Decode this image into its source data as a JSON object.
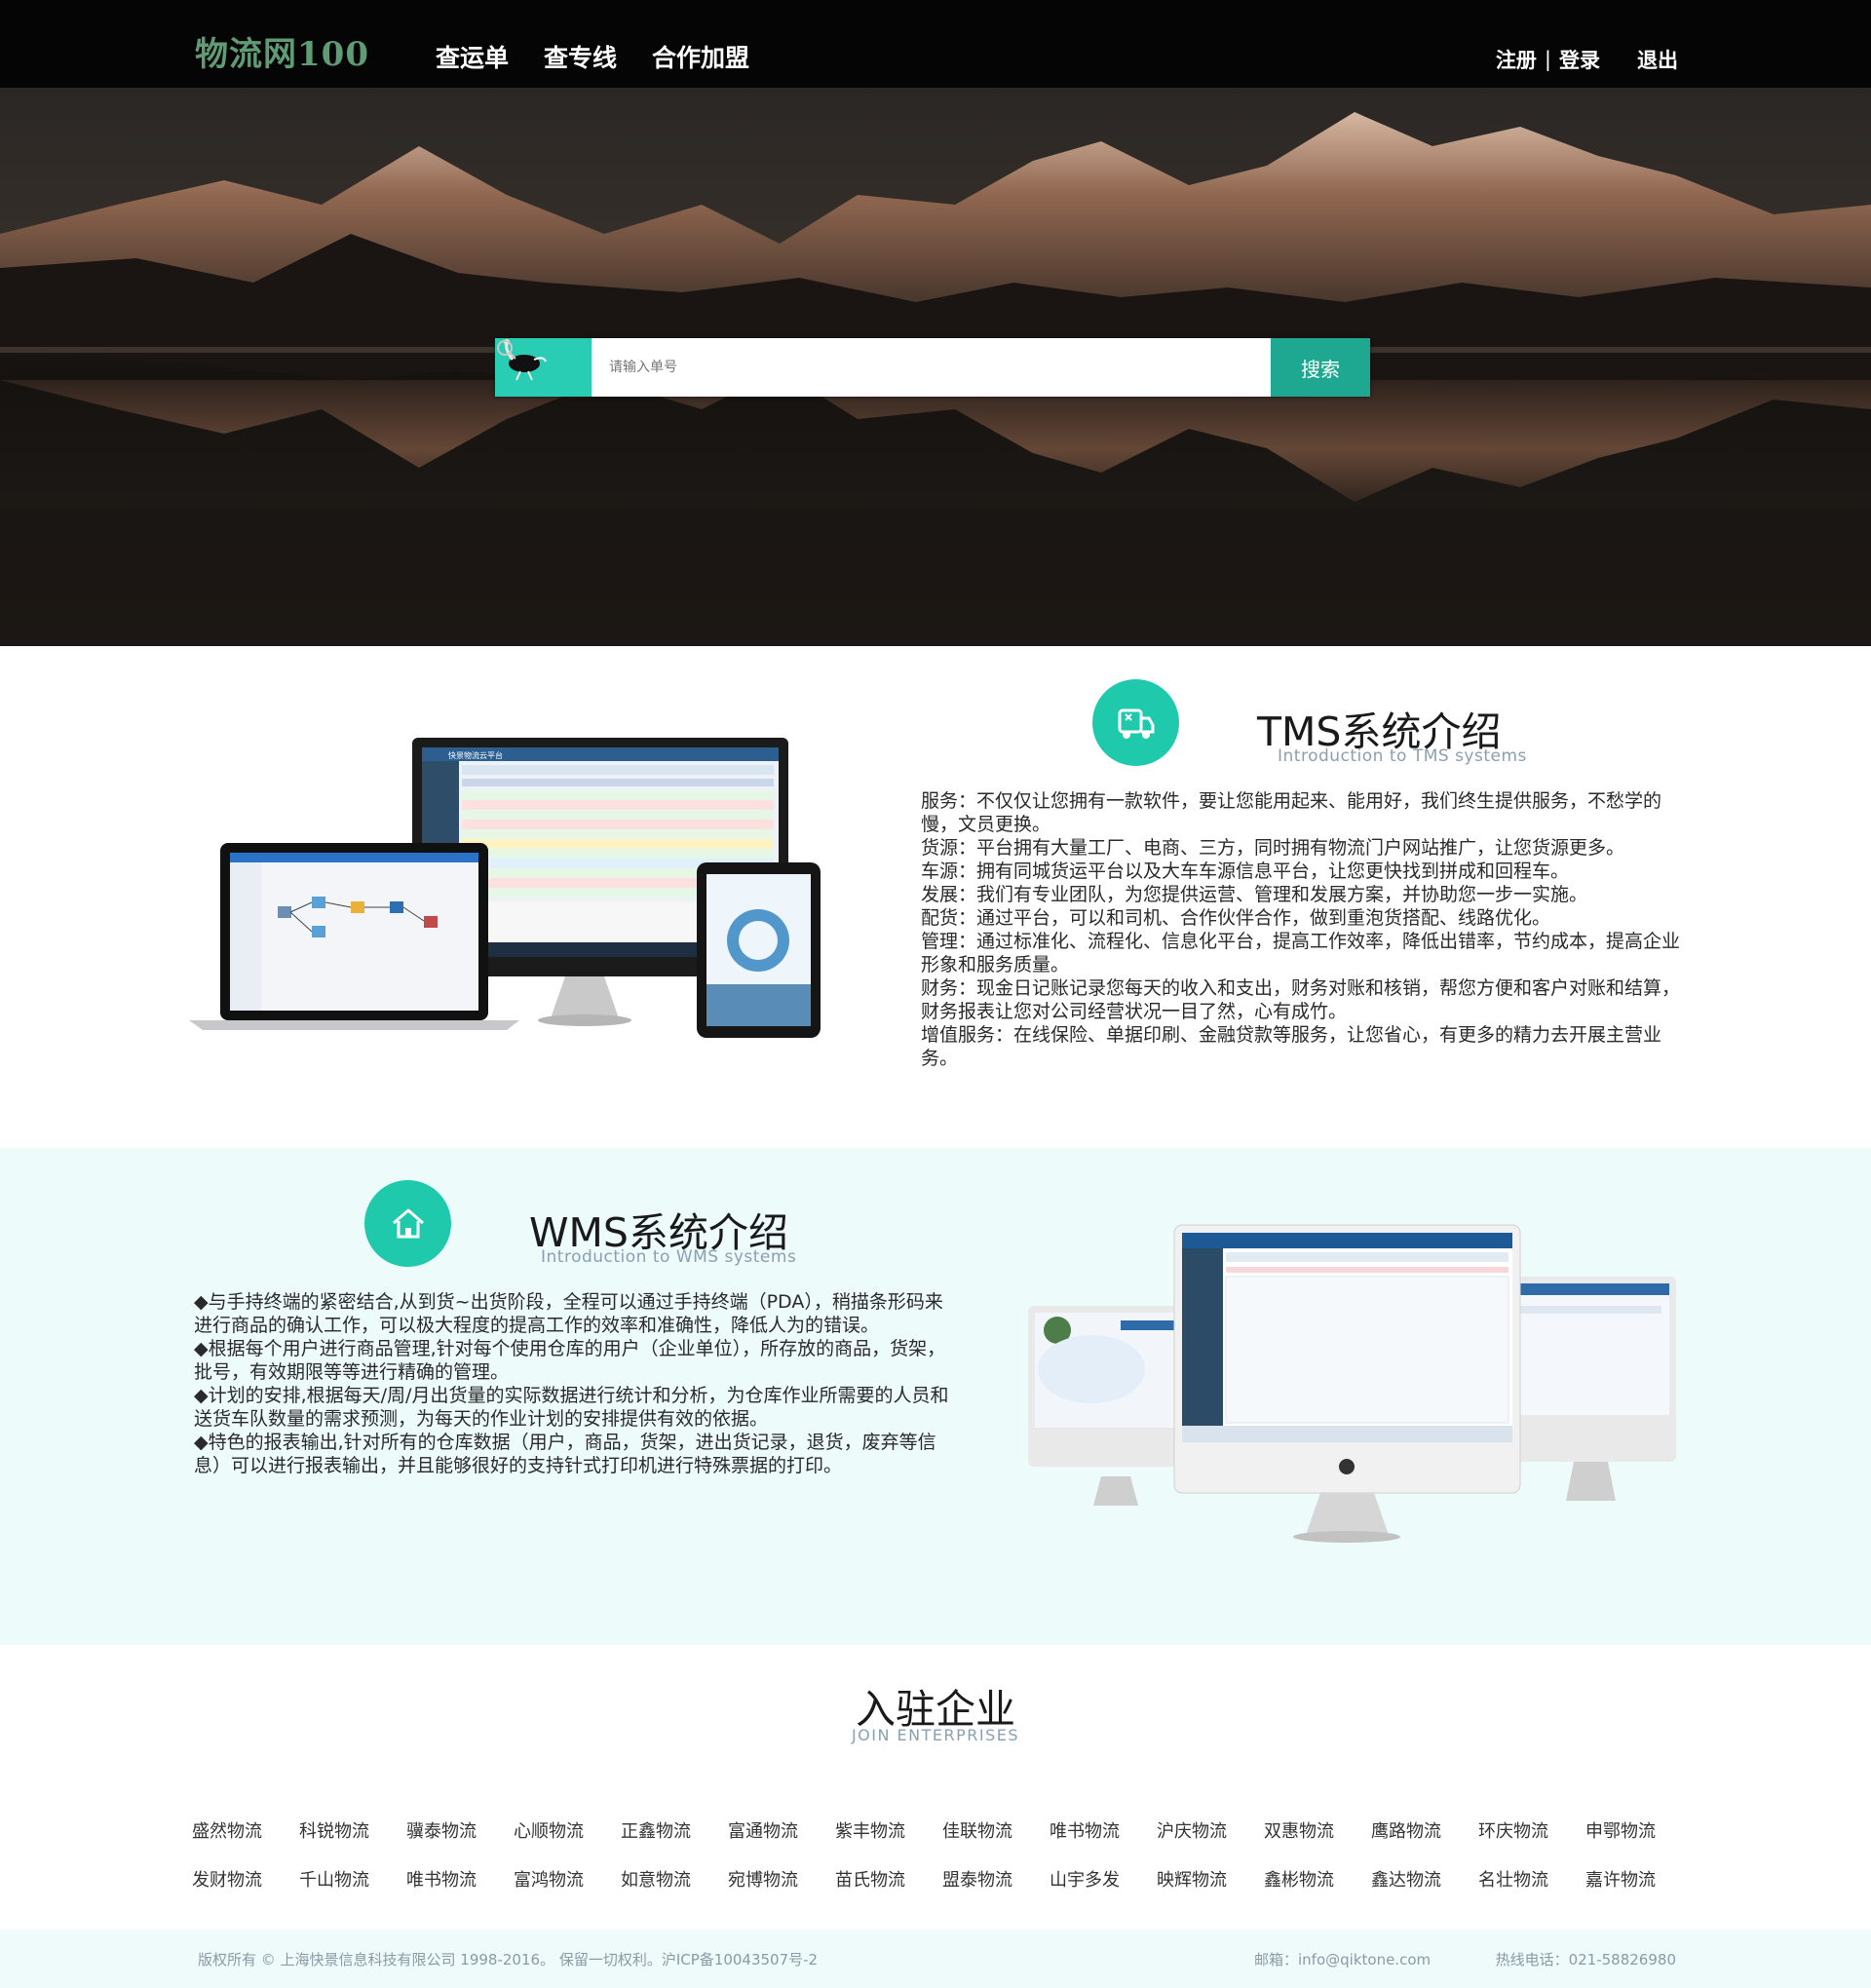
{
  "header": {
    "logo": "物流网100",
    "nav": [
      "查运单",
      "查专线",
      "合作加盟"
    ],
    "register": "注册",
    "separator": "|",
    "login": "登录",
    "logout": "退出"
  },
  "search": {
    "badge_icon": "ostrich-icon",
    "placeholder": "请输入单号",
    "button": "搜索"
  },
  "tms": {
    "icon": "delivery-truck-icon",
    "title": "TMS系统介绍",
    "subtitle": "Introduction to TMS systems",
    "screen_header": "快景物流云平台",
    "paragraphs": [
      "服务：不仅仅让您拥有一款软件，要让您能用起来、能用好，我们终生提供服务，不愁学的慢，文员更换。",
      "货源：平台拥有大量工厂、电商、三方，同时拥有物流门户网站推广，让您货源更多。",
      "车源：拥有同城货运平台以及大车车源信息平台，让您更快找到拼成和回程车。",
      "发展：我们有专业团队，为您提供运营、管理和发展方案，并协助您一步一实施。",
      "配货：通过平台，可以和司机、合作伙伴合作，做到重泡货搭配、线路优化。",
      "管理：通过标准化、流程化、信息化平台，提高工作效率，降低出错率，节约成本，提高企业形象和服务质量。",
      "财务：现金日记账记录您每天的收入和支出，财务对账和核销，帮您方便和客户对账和结算，财务报表让您对公司经营状况一目了然，心有成竹。",
      "增值服务：在线保险、单据印刷、金融贷款等服务，让您省心，有更多的精力去开展主营业务。"
    ]
  },
  "wms": {
    "icon": "home-icon",
    "title": "WMS系统介绍",
    "subtitle": "Introduction to WMS systems",
    "paragraphs": [
      "◆与手持终端的紧密结合,从到货~出货阶段，全程可以通过手持终端（PDA），稍描条形码来进行商品的确认工作，可以极大程度的提高工作的效率和准确性，降低人为的错误。",
      "◆根据每个用户进行商品管理,针对每个使用仓库的用户（企业单位），所存放的商品，货架，批号，有效期限等等进行精确的管理。",
      "◆计划的安排,根据每天/周/月出货量的实际数据进行统计和分析，为仓库作业所需要的人员和送货车队数量的需求预测，为每天的作业计划的安排提供有效的依据。",
      "◆特色的报表输出,针对所有的仓库数据（用户，商品，货架，进出货记录，退货，废弃等信息）可以进行报表输出，并且能够很好的支持针式打印机进行特殊票据的打印。"
    ]
  },
  "enterprises": {
    "title": "入驻企业",
    "subtitle": "JOIN ENTERPRISES",
    "rows": [
      [
        "盛然物流",
        "科锐物流",
        "骥泰物流",
        "心顺物流",
        "正鑫物流",
        "富通物流",
        "紫丰物流",
        "佳联物流",
        "唯书物流",
        "沪庆物流",
        "双惠物流",
        "鹰路物流",
        "环庆物流",
        "申鄂物流"
      ],
      [
        "发财物流",
        "千山物流",
        "唯书物流",
        "富鸿物流",
        "如意物流",
        "宛博物流",
        "苗氏物流",
        "盟泰物流",
        "山宇多发",
        "映辉物流",
        "鑫彬物流",
        "鑫达物流",
        "名壮物流",
        "嘉许物流"
      ]
    ]
  },
  "footer": {
    "copyright": "版权所有 © 上海快景信息科技有限公司 1998-2016。 保留一切权利。沪ICP备10043507号-2",
    "email": "邮箱：info@qiktone.com",
    "phone": "热线电话：021-58826980"
  },
  "colors": {
    "accent": "#1ec9ac",
    "search_button": "#1fa891",
    "header_bg": "#050505",
    "wms_band": "#edfbfb"
  }
}
